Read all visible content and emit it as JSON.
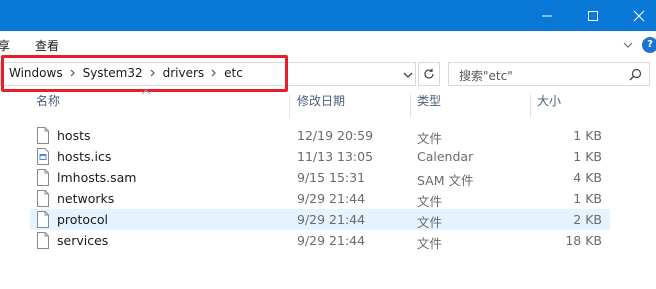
{
  "ribbon": {
    "tabs": [
      "享",
      "查看"
    ]
  },
  "breadcrumb": [
    "Windows",
    "System32",
    "drivers",
    "etc"
  ],
  "search": {
    "placeholder": "搜索\"etc\""
  },
  "columns": {
    "name": "名称",
    "date": "修改日期",
    "type": "类型",
    "size": "大小"
  },
  "files": [
    {
      "name": "hosts",
      "date": "12/19 20:59",
      "type": "文件",
      "size": "1 KB",
      "icon": "file-icon"
    },
    {
      "name": "hosts.ics",
      "date": "11/13 13:05",
      "type": "Calendar",
      "size": "1 KB",
      "icon": "calendar-file-icon"
    },
    {
      "name": "lmhosts.sam",
      "date": "9/15 15:31",
      "type": "SAM 文件",
      "size": "4 KB",
      "icon": "file-icon"
    },
    {
      "name": "networks",
      "date": "9/29 21:44",
      "type": "文件",
      "size": "1 KB",
      "icon": "file-icon"
    },
    {
      "name": "protocol",
      "date": "9/29 21:44",
      "type": "文件",
      "size": "2 KB",
      "icon": "file-icon",
      "selected": true
    },
    {
      "name": "services",
      "date": "9/29 21:44",
      "type": "文件",
      "size": "18 KB",
      "icon": "file-icon"
    }
  ],
  "colors": {
    "titlebar": "#0a78d7",
    "highlight": "#e51e2a",
    "selection": "#e5f3ff"
  }
}
